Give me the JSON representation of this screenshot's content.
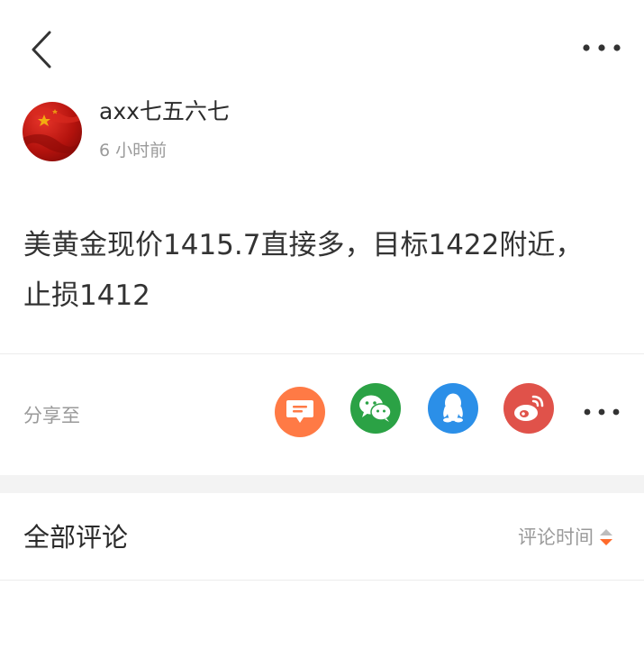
{
  "header": {
    "back_icon": "chevron-left-icon",
    "more_icon": "more-horizontal-icon"
  },
  "post": {
    "author": "axx七五六七",
    "time": "6 小时前",
    "content": "美黄金现价1415.7直接多，目标1422附近，止损1412"
  },
  "share": {
    "label": "分享至",
    "targets": [
      {
        "name": "comment-share",
        "icon": "chat-bubble-icon",
        "color": "#ff7a45"
      },
      {
        "name": "wechat",
        "icon": "wechat-icon",
        "color": "#2ba245"
      },
      {
        "name": "qq",
        "icon": "qq-penguin-icon",
        "color": "#2b8fe8"
      },
      {
        "name": "weibo",
        "icon": "weibo-icon",
        "color": "#e0524a"
      }
    ],
    "more_icon": "more-horizontal-icon"
  },
  "comments": {
    "title": "全部评论",
    "sort_label": "评论时间",
    "sort_icon": "sort-toggle-icon",
    "sort_accent": "#ff6a2b"
  }
}
